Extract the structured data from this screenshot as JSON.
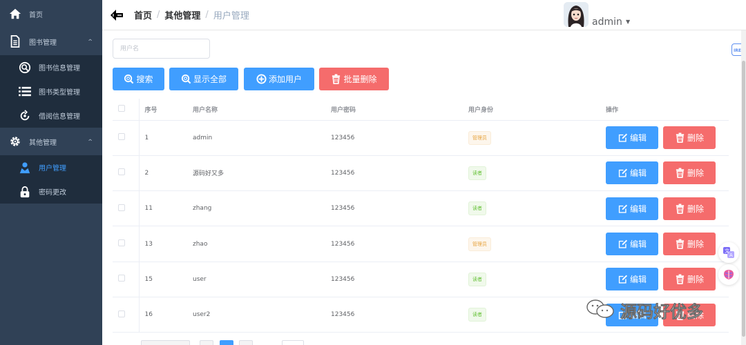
{
  "sidebar": {
    "items": [
      {
        "label": "首页",
        "icon": "home-icon",
        "type": "top"
      },
      {
        "label": "图书管理",
        "icon": "document-icon",
        "type": "top",
        "arrow": "^"
      },
      {
        "label": "图书信息管理",
        "icon": "search-circle-icon",
        "type": "sub"
      },
      {
        "label": "图书类型管理",
        "icon": "list-icon",
        "type": "sub"
      },
      {
        "label": "借阅信息管理",
        "icon": "refresh-circle-icon",
        "type": "sub"
      },
      {
        "label": "其他管理",
        "icon": "gear-icon",
        "type": "top",
        "arrow": "^"
      },
      {
        "label": "用户管理",
        "icon": "user-icon",
        "type": "sub",
        "active": true
      },
      {
        "label": "密码更改",
        "icon": "lock-icon",
        "type": "sub"
      }
    ]
  },
  "header": {
    "breadcrumb": [
      "首页",
      "其他管理",
      "用户管理"
    ],
    "separator": "/",
    "user_name": "admin",
    "caret": "▼"
  },
  "toolbar": {
    "search_placeholder": "用户名",
    "search_label": "搜索",
    "show_all_label": "显示全部",
    "add_user_label": "添加用户",
    "batch_delete_label": "批量删除"
  },
  "table": {
    "columns": [
      "序号",
      "用户名称",
      "用户密码",
      "用户身份",
      "操作"
    ],
    "rows": [
      {
        "id": "1",
        "name": "admin",
        "password": "123456",
        "role": "管理员",
        "role_type": "warn"
      },
      {
        "id": "2",
        "name": "源码好又多",
        "password": "123456",
        "role": "读者",
        "role_type": "ok"
      },
      {
        "id": "11",
        "name": "zhang",
        "password": "123456",
        "role": "读者",
        "role_type": "ok"
      },
      {
        "id": "13",
        "name": "zhao",
        "password": "123456",
        "role": "管理员",
        "role_type": "warn"
      },
      {
        "id": "15",
        "name": "user",
        "password": "123456",
        "role": "读者",
        "role_type": "ok"
      },
      {
        "id": "16",
        "name": "user2",
        "password": "123456",
        "role": "读者",
        "role_type": "ok"
      }
    ],
    "edit_label": "编辑",
    "delete_label": "删除"
  },
  "watermark": {
    "text": "源码好优多"
  },
  "colors": {
    "primary": "#409eff",
    "danger": "#f56c6c",
    "sidebar": "#304156",
    "sidebar_sub": "#1f2d3d"
  }
}
